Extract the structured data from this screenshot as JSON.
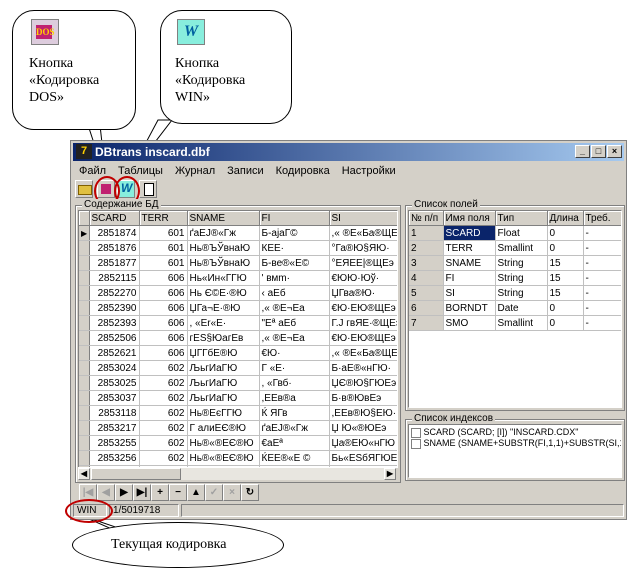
{
  "callouts": {
    "dos": {
      "line1": "Кнопка",
      "line2": "«Кодировка",
      "line3": "DOS»"
    },
    "win": {
      "line1": "Кнопка",
      "line2": "«Кодировка",
      "line3": "WIN»"
    },
    "current": {
      "text": "Текущая кодировка"
    }
  },
  "window": {
    "title": "DBtrans inscard.dbf"
  },
  "menu": [
    "Файл",
    "Таблицы",
    "Журнал",
    "Записи",
    "Кодировка",
    "Настройки"
  ],
  "left_panel": {
    "title": "Содержание БД",
    "columns": [
      "SCARD",
      "TERR",
      "SNAME",
      "FI",
      "SI"
    ],
    "rows": [
      [
        "2851874",
        "601",
        "ґаЕЈ®«Гж",
        "Б-ајаГ©",
        ",« ®Е«Бa®ЩЕэ"
      ],
      [
        "2851876",
        "601",
        "Нь®ЪЎвнаЮ",
        "КЕЕ·",
        "°Га®Ю§ЯЮ·"
      ],
      [
        "2851877",
        "601",
        "Нь®ЪЎвнаЮ",
        "Б-ве®«Е©",
        "°ЕЯЕЕ|®ЩЕэ"
      ],
      [
        "2852115",
        "606",
        "Нь«Ин«ГГЮ",
        "' вмm·",
        "€ЮЮ·Юў·"
      ],
      [
        "2852270",
        "606",
        "Нь Є©Е·®Ю",
        "‹ аЕб",
        "ЏГва®Ю·"
      ],
      [
        "2852390",
        "606",
        "ЏГа¬Е·®Ю",
        ",« ®Е¬Еа",
        "€Ю·ЕЮ®ЩЕэ"
      ],
      [
        "2852393",
        "606",
        ", «Еr«Е·",
        "\"Еª аЕб",
        "Г.Ј гвЯЕ·®ЩЕэ"
      ],
      [
        "2852506",
        "606",
        "гЕЅ§ЮагЕв",
        ",« ®Е¬Еа",
        "€Ю·ЕЮ®ЩЕэ"
      ],
      [
        "2852621",
        "606",
        "ЏГГбЕ®Ю",
        "€Ю·",
        ",« ®Е«Бa®ЩЕэ"
      ],
      [
        "2853024",
        "602",
        "ЉьгИаГЮ",
        "Г «Е·",
        "Б·аЕ®«нГЮ·"
      ],
      [
        "2853025",
        "602",
        "ЉьгИаГЮ",
        ", «Гвб·",
        "ЏЄ®Ю§ГЮЕэ"
      ],
      [
        "2853037",
        "602",
        "ЉьгИаГЮ",
        ",ЕЕв®а",
        "Б·в®ЮвЕэ"
      ],
      [
        "2853118",
        "602",
        "Нь®ЕєГГЮ",
        "Ќ ЯГв",
        ",ЕЕв®Ю§ЕЮ·"
      ],
      [
        "2853217",
        "602",
        "Г алиЕЄ®Ю",
        "ґаЕЈ®«Гж",
        "Џ Ю«®ЮЕэ"
      ],
      [
        "2853255",
        "602",
        "Нь®«®ЕЄ®Ю",
        "€аЕª",
        "Џа®ЕЮ«нГЮ"
      ],
      [
        "2853256",
        "602",
        "Нь®«®ЕЄ®Ю",
        "ЌЕЕ®«Е ©",
        "Бь«ЕЅбЯГЮЕэ"
      ],
      [
        "2853273",
        "602",
        "·Еа]Е·",
        "Б-ајаГ©",
        "ЌЕЕ®ЮЗГЮЕэ"
      ],
      [
        "2853335",
        "602",
        "·®-Е·",
        "€смп",
        ",« ®Е¬Еа"
      ]
    ]
  },
  "fields_panel": {
    "title": "Список полей",
    "columns": [
      "№ п/п",
      "Имя поля",
      "Тип",
      "Длина",
      "Треб."
    ],
    "rows": [
      [
        "1",
        "SCARD",
        "Float",
        "0",
        "-"
      ],
      [
        "2",
        "TERR",
        "Smallint",
        "0",
        "-"
      ],
      [
        "3",
        "SNAME",
        "String",
        "15",
        "-"
      ],
      [
        "4",
        "FI",
        "String",
        "15",
        "-"
      ],
      [
        "5",
        "SI",
        "String",
        "15",
        "-"
      ],
      [
        "6",
        "BORNDT",
        "Date",
        "0",
        "-"
      ],
      [
        "7",
        "SMO",
        "Smallint",
        "0",
        "-"
      ]
    ]
  },
  "indexes_panel": {
    "title": "Список индексов",
    "items": [
      "SCARD (SCARD; [I]) \"INSCARD.CDX\"",
      "SNAME (SNAME+SUBSTR(FI,1,1)+SUBSTR(SI,1,1)+D"
    ]
  },
  "status": {
    "encoding": "WIN",
    "record": "1/5019718"
  }
}
